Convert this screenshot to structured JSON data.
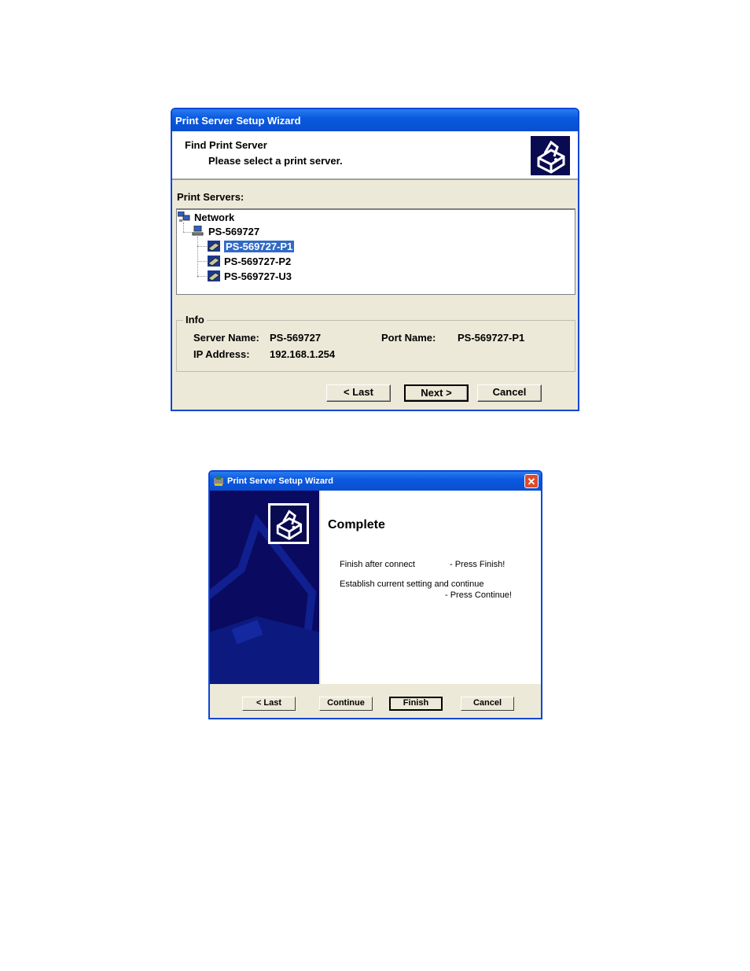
{
  "dialog1": {
    "title": "Print Server Setup Wizard",
    "header_title": "Find Print Server",
    "header_subtitle": "Please select a print server.",
    "header_icon": "printer-icon",
    "list_label": "Print Servers:",
    "tree": {
      "root": {
        "label": "Network",
        "icon": "network-icon"
      },
      "server": {
        "label": "PS-569727",
        "icon": "computer-icon"
      },
      "ports": [
        {
          "label": "PS-569727-P1",
          "icon": "port-icon",
          "selected": true
        },
        {
          "label": "PS-569727-P2",
          "icon": "port-icon",
          "selected": false
        },
        {
          "label": "PS-569727-U3",
          "icon": "port-icon",
          "selected": false
        }
      ]
    },
    "info": {
      "legend": "Info",
      "server_name_label": "Server Name:",
      "server_name_value": "PS-569727",
      "port_name_label": "Port Name:",
      "port_name_value": "PS-569727-P1",
      "ip_label": "IP Address:",
      "ip_value": "192.168.1.254"
    },
    "buttons": {
      "last": "< Last",
      "next": "Next >",
      "cancel": "Cancel"
    }
  },
  "dialog2": {
    "title": "Print Server Setup Wizard",
    "close_label": "✕",
    "heading": "Complete",
    "line1_left": "Finish after connect",
    "line1_right": "- Press Finish!",
    "line2": "Establish current setting and continue",
    "line3": "- Press Continue!",
    "buttons": {
      "last": "< Last",
      "continue": "Continue",
      "finish": "Finish",
      "cancel": "Cancel"
    }
  },
  "colors": {
    "titlebar": "#0a5ae0",
    "selection": "#316ac5",
    "dialog_bg": "#ece9d8",
    "side_panel": "#0a0a60"
  }
}
